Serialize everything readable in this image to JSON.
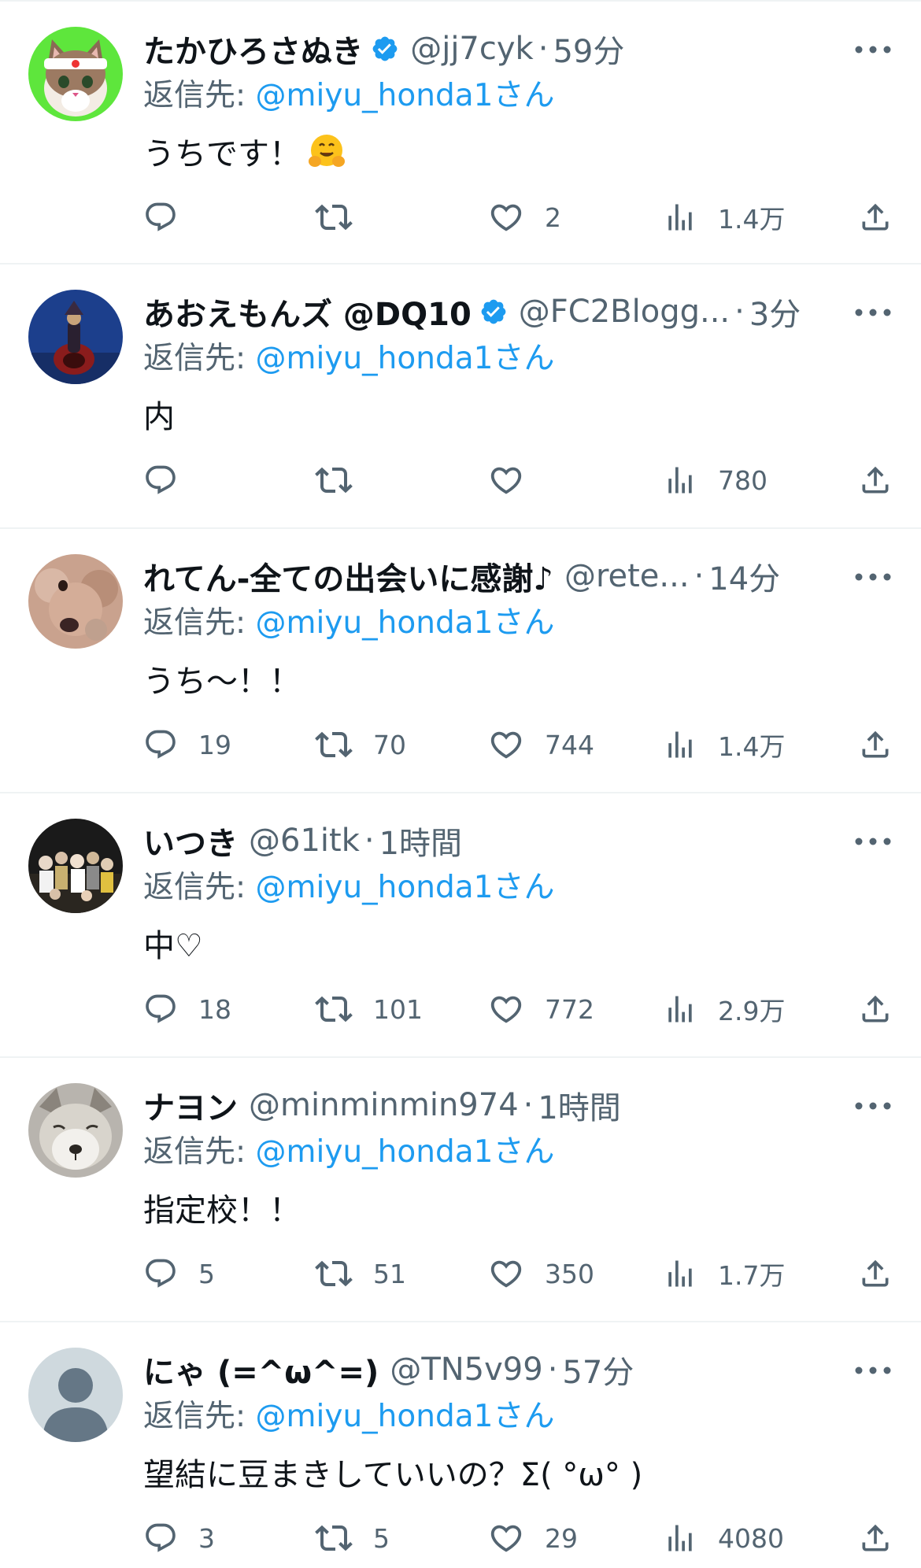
{
  "reply_prefix": "返信先:",
  "reply_suffix": "さん",
  "colors": {
    "accent": "#1d9bf0",
    "text_primary": "#0f1419",
    "text_secondary": "#536471",
    "divider": "#eff3f4"
  },
  "icons": {
    "reply": "reply-icon",
    "retweet": "retweet-icon",
    "like": "heart-icon",
    "views": "views-icon",
    "share": "share-icon",
    "more": "more-icon",
    "verified": "verified-badge-icon"
  },
  "tweets": [
    {
      "name": "たかひろさぬき",
      "verified": true,
      "handle": "@jj7cyk",
      "dot": "·",
      "time": "59分",
      "reply_to": "@miyu_honda1",
      "text": "うちです！",
      "emoji": "hugging-face-emoji",
      "replies": "",
      "retweets": "",
      "likes": "2",
      "views": "1.4万",
      "avatar": "cat-headband-avatar"
    },
    {
      "name": "あおえもんズ @DQ10",
      "verified": true,
      "handle": "@FC2Blogg...",
      "dot": "·",
      "time": "3分",
      "reply_to": "@miyu_honda1",
      "text": "内",
      "replies": "",
      "retweets": "",
      "likes": "",
      "views": "780",
      "avatar": "dark-blue-character-avatar"
    },
    {
      "name": "れてん-全ての出会いに感謝♪",
      "verified": false,
      "handle": "@rete...",
      "dot": "·",
      "time": "14分",
      "reply_to": "@miyu_honda1",
      "text": "うち〜！！",
      "replies": "19",
      "retweets": "70",
      "likes": "744",
      "views": "1.4万",
      "avatar": "dog-avatar"
    },
    {
      "name": "いつき",
      "verified": false,
      "handle": "@61itk",
      "dot": "·",
      "time": "1時間",
      "reply_to": "@miyu_honda1",
      "text": "中♡",
      "replies": "18",
      "retweets": "101",
      "likes": "772",
      "views": "2.9万",
      "avatar": "group-photo-avatar"
    },
    {
      "name": "ナヨン",
      "verified": false,
      "handle": "@minminmin974",
      "dot": "·",
      "time": "1時間",
      "reply_to": "@miyu_honda1",
      "text": "指定校！！",
      "replies": "5",
      "retweets": "51",
      "likes": "350",
      "views": "1.7万",
      "avatar": "fox-avatar"
    },
    {
      "name": "にゃ (=^ω^=)",
      "verified": false,
      "handle": "@TN5v99",
      "dot": "·",
      "time": "57分",
      "reply_to": "@miyu_honda1",
      "text": "望結に豆まきしていいの？Σ( °ω° )",
      "replies": "3",
      "retweets": "5",
      "likes": "29",
      "views": "4080",
      "avatar": "default-avatar"
    }
  ]
}
